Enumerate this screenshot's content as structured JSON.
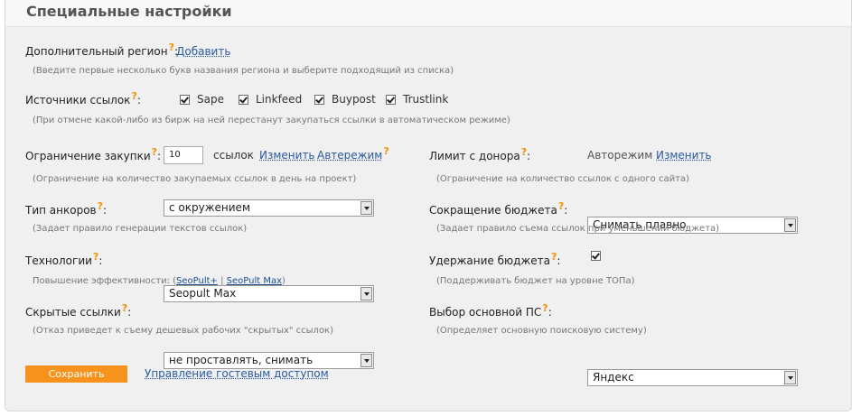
{
  "title": "Специальные настройки",
  "q_mark": "?",
  "extra_region": {
    "label": "Дополнительный регион",
    "link": "Добавить",
    "hint": "(Введите первые несколько букв названия региона и выберите подходящий из списка)"
  },
  "link_sources": {
    "label": "Источники ссылок",
    "items": [
      {
        "label": "Sape",
        "checked": true
      },
      {
        "label": "Linkfeed",
        "checked": true
      },
      {
        "label": "Buypost",
        "checked": true
      },
      {
        "label": "Trustlink",
        "checked": true
      }
    ],
    "hint": "(При отмене какой-либо из бирж на ней перестанут закупаться ссылки в автоматическом режиме)"
  },
  "purchase_limit": {
    "label": "Ограничение закупки",
    "value": "10",
    "unit": "ссылок",
    "change_link": "Изменить",
    "auto_link": "Автережим",
    "hint": "(Ограничение на количество закупаемых ссылок в день на проект)"
  },
  "donor_limit": {
    "label": "Лимит с донора",
    "value": "Авторежим",
    "change_link": "Изменить",
    "hint": "(Ограничение на количество ссылок с одного сайта)"
  },
  "anchor_type": {
    "label": "Тип анкоров",
    "selected": "с окружением",
    "hint": "(Задает правило генерации текстов ссылок)"
  },
  "budget_cut": {
    "label": "Сокращение бюджета",
    "selected": "Снимать плавно",
    "hint": "(Задает правило съема ссылок при уменьшении бюджета)"
  },
  "technologies": {
    "label": "Технологии",
    "selected": "Seopult Max",
    "hint_prefix": "Повышение эффективности: (",
    "link1": "SeoPult+",
    "sep": " | ",
    "link2": "SeoPult Max",
    "hint_suffix": ")"
  },
  "budget_hold": {
    "label": "Удержание бюджета",
    "checked": true,
    "hint": "(Поддерживать бюджет на уровне ТОПа)"
  },
  "hidden_links": {
    "label": "Скрытые ссылки",
    "selected": "не проставлять, снимать",
    "hint": "(Отказ приведет к съему дешевых рабочих \"скрытых\" ссылок)"
  },
  "main_search": {
    "label": "Выбор основной ПС",
    "selected": "Яндекс",
    "hint": "(Определяет основную поисковую систему)"
  },
  "save_button": "Сохранить",
  "guest_access_link": "Управление гостевым доступом",
  "colors": {
    "accent_orange": "#f7921d",
    "link_blue": "#2a5a9e",
    "panel_bg": "#f0f0f0"
  }
}
